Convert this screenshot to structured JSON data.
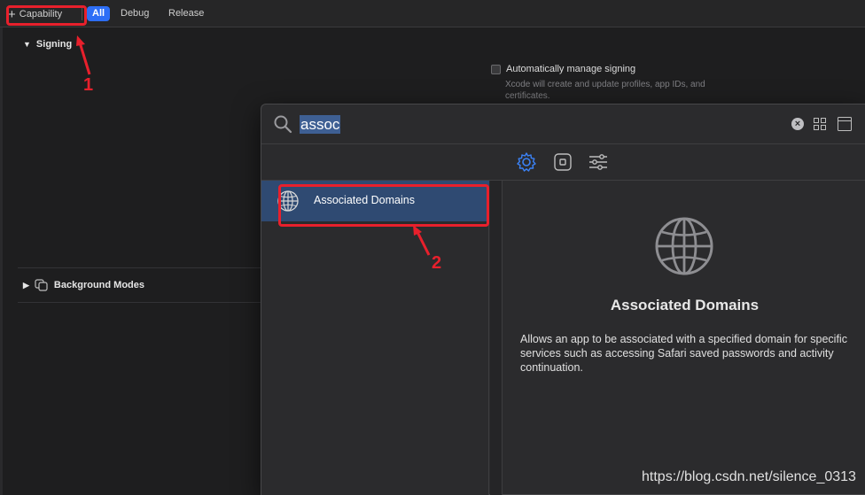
{
  "toolbar": {
    "capability_label": "Capability",
    "segments": [
      {
        "label": "All",
        "selected": true
      },
      {
        "label": "Debug",
        "selected": false
      },
      {
        "label": "Release",
        "selected": false
      }
    ]
  },
  "signing": {
    "title": "Signing",
    "auto_manage_label": "Automatically manage signing",
    "auto_manage_checked": false,
    "auto_manage_desc": "Xcode will create and update profiles, app IDs, and certificates."
  },
  "background_modes": {
    "title": "Background Modes"
  },
  "library": {
    "search_value": "assoc",
    "filter_icons": [
      "gear-icon",
      "square-icon",
      "sliders-icon"
    ],
    "results": [
      {
        "label": "Associated Domains",
        "icon": "globe-icon",
        "selected": true
      }
    ],
    "detail": {
      "icon": "globe-icon",
      "title": "Associated Domains",
      "description": "Allows an app to be associated with a specified domain for specific services such as accessing Safari saved passwords and activity continuation."
    }
  },
  "annotations": [
    {
      "number": "1"
    },
    {
      "number": "2"
    }
  ],
  "colors": {
    "accent": "#2d6ef6",
    "annotation_red": "#e8202c",
    "selection": "#2f4a72"
  },
  "watermark": "https://blog.csdn.net/silence_0313"
}
